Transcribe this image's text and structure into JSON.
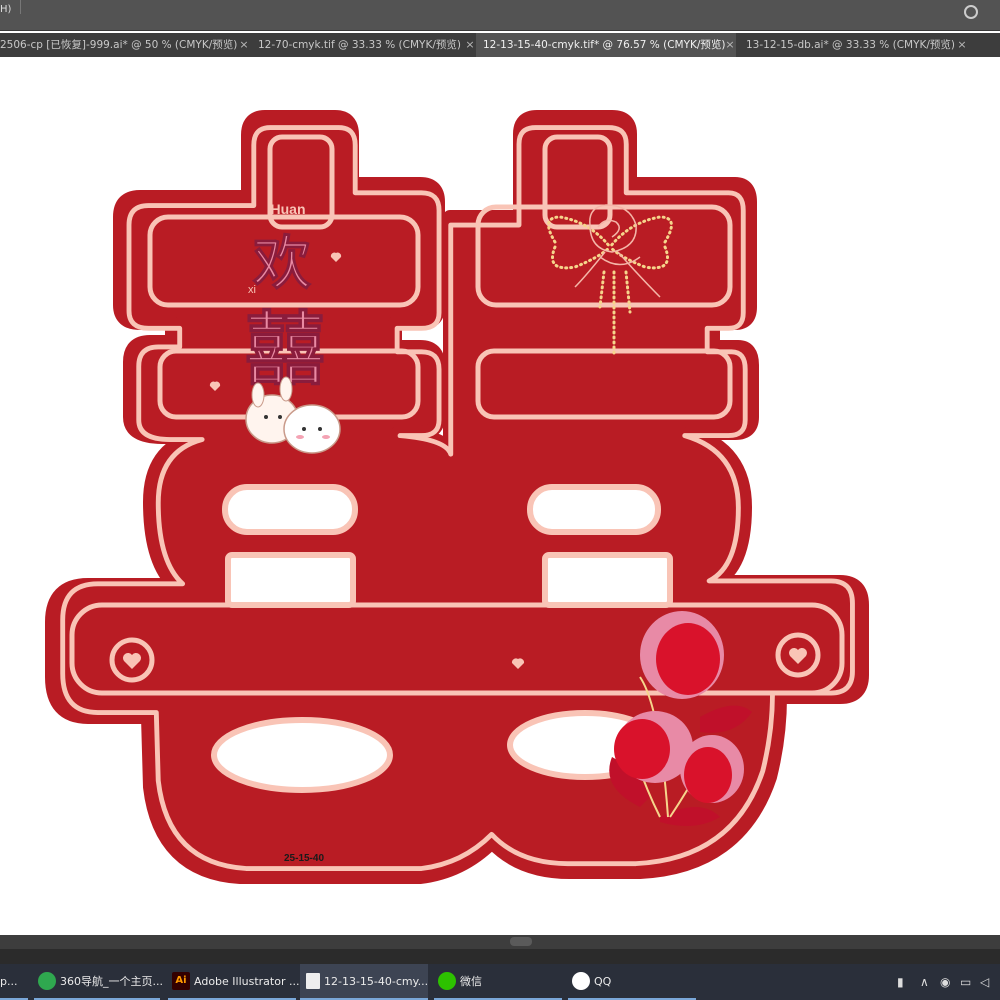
{
  "app": {
    "menu_stub": "H)",
    "tabs": [
      {
        "label": "2506-cp [已恢复]-999.ai* @ 50 % (CMYK/预览)",
        "close": "×"
      },
      {
        "label": "12-70-cmyk.tif @ 33.33 % (CMYK/预览)",
        "close": "×"
      },
      {
        "label": "12-13-15-40-cmyk.tif* @ 76.57 % (CMYK/预览)",
        "close": "×"
      },
      {
        "label": "13-12-15-db.ai* @ 33.33 % (CMYK/预览)",
        "close": "×"
      }
    ]
  },
  "artwork": {
    "huan_pinyin": "Huan",
    "huan_char": "欢",
    "xi_pinyin": "xi",
    "xi_char": "囍",
    "size_label": "25-15-40",
    "colors": {
      "red": "#b91c24",
      "outline": "#f9c4b6",
      "pink": "#e98aa3",
      "gold": "#f6d58c",
      "flower": "#d9122b"
    }
  },
  "taskbar": {
    "items": [
      {
        "label": "p..."
      },
      {
        "label": "360导航_一个主页..."
      },
      {
        "label": "Adobe Illustrator ..."
      },
      {
        "label": "12-13-15-40-cmy..."
      },
      {
        "label": "微信"
      },
      {
        "label": "QQ"
      }
    ],
    "ai_icon_text": "Ai"
  },
  "tray": {
    "icons": [
      "battery-icon",
      "chevron-up-icon",
      "network-icon",
      "display-icon",
      "volume-icon"
    ]
  }
}
